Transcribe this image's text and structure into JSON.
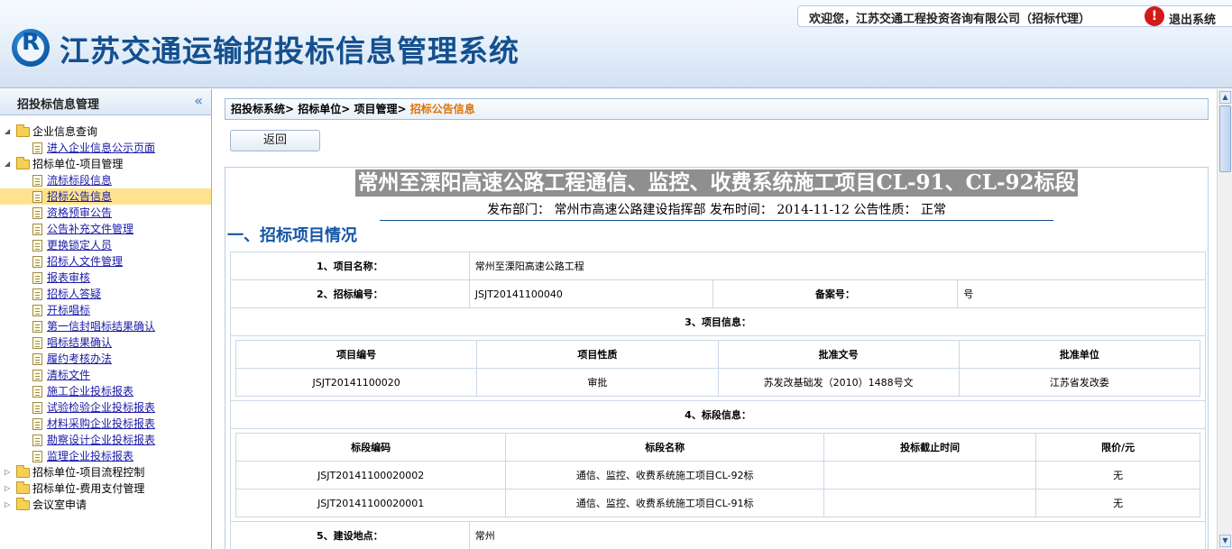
{
  "header": {
    "logo_letter": "R",
    "system_title": "江苏交通运输招投标信息管理系统",
    "welcome": "欢迎您，江苏交通工程投资咨询有限公司（招标代理）",
    "logout": "退出系统"
  },
  "sidebar": {
    "title": "招投标信息管理",
    "collapse": "«",
    "tree": [
      {
        "label": "企业信息查询",
        "type": "folder",
        "level": 0,
        "expanded": true
      },
      {
        "label": "进入企业信息公示页面",
        "type": "leaf",
        "level": 1
      },
      {
        "label": "招标单位-项目管理",
        "type": "folder",
        "level": 0,
        "expanded": true
      },
      {
        "label": "流标标段信息",
        "type": "leaf",
        "level": 1
      },
      {
        "label": "招标公告信息",
        "type": "leaf",
        "level": 1,
        "selected": true
      },
      {
        "label": "资格预审公告",
        "type": "leaf",
        "level": 1
      },
      {
        "label": "公告补充文件管理",
        "type": "leaf",
        "level": 1
      },
      {
        "label": "更换锁定人员",
        "type": "leaf",
        "level": 1
      },
      {
        "label": "招标人文件管理",
        "type": "leaf",
        "level": 1
      },
      {
        "label": "报表审核",
        "type": "leaf",
        "level": 1
      },
      {
        "label": "招标人答疑",
        "type": "leaf",
        "level": 1
      },
      {
        "label": "开标唱标",
        "type": "leaf",
        "level": 1
      },
      {
        "label": "第一信封唱标结果确认",
        "type": "leaf",
        "level": 1
      },
      {
        "label": "唱标结果确认",
        "type": "leaf",
        "level": 1
      },
      {
        "label": "履约考核办法",
        "type": "leaf",
        "level": 1
      },
      {
        "label": "清标文件",
        "type": "leaf",
        "level": 1
      },
      {
        "label": "施工企业投标报表",
        "type": "leaf",
        "level": 1
      },
      {
        "label": "试验检验企业投标报表",
        "type": "leaf",
        "level": 1
      },
      {
        "label": "材料采购企业投标报表",
        "type": "leaf",
        "level": 1
      },
      {
        "label": "勘察设计企业投标报表",
        "type": "leaf",
        "level": 1
      },
      {
        "label": "监理企业投标报表",
        "type": "leaf",
        "level": 1
      },
      {
        "label": "招标单位-项目流程控制",
        "type": "folder",
        "level": 0,
        "expanded": false
      },
      {
        "label": "招标单位-费用支付管理",
        "type": "folder",
        "level": 0,
        "expanded": false
      },
      {
        "label": "会议室申请",
        "type": "folder",
        "level": 0,
        "expanded": false
      }
    ]
  },
  "breadcrumb": {
    "path": "招投标系统> 招标单位> 项目管理> ",
    "current": "招标公告信息"
  },
  "back_button": "返回",
  "announcement": {
    "title": "常州至溧阳高速公路工程通信、监控、收费系统施工项目CL-91、CL-92标段",
    "meta": "发布部门： 常州市高速公路建设指挥部 发布时间： 2014-11-12 公告性质： 正常",
    "section1": "一、招标项目情况",
    "project_name_label": "1、项目名称：",
    "project_name": "常州至溧阳高速公路工程",
    "tender_no_label": "2、招标编号：",
    "tender_no": "JSJT20141100040",
    "record_no_label": "备案号：",
    "record_no": "号",
    "project_info_label": "3、项目信息：",
    "project_info": {
      "headers": [
        "项目编号",
        "项目性质",
        "批准文号",
        "批准单位"
      ],
      "rows": [
        [
          "JSJT20141100020",
          "审批",
          "苏发改基础发（2010）1488号文",
          "江苏省发改委"
        ]
      ]
    },
    "section_info_label": "4、标段信息：",
    "section_info": {
      "headers": [
        "标段编码",
        "标段名称",
        "投标截止时间",
        "限价/元"
      ],
      "rows": [
        [
          "JSJT20141100020002",
          "通信、监控、收费系统施工项目CL-92标",
          "",
          "无"
        ],
        [
          "JSJT20141100020001",
          "通信、监控、收费系统施工项目CL-91标",
          "",
          "无"
        ]
      ]
    },
    "location_label": "5、建设地点：",
    "location": "常州"
  },
  "icons": {
    "logout_icon": "!",
    "scroll_up": "▲",
    "scroll_down": "▼"
  },
  "colors": {
    "title_blue": "#14508f",
    "breadcrumb_current": "#e07000",
    "selected_bg": "#fde38e",
    "logout_red": "#d41919"
  }
}
